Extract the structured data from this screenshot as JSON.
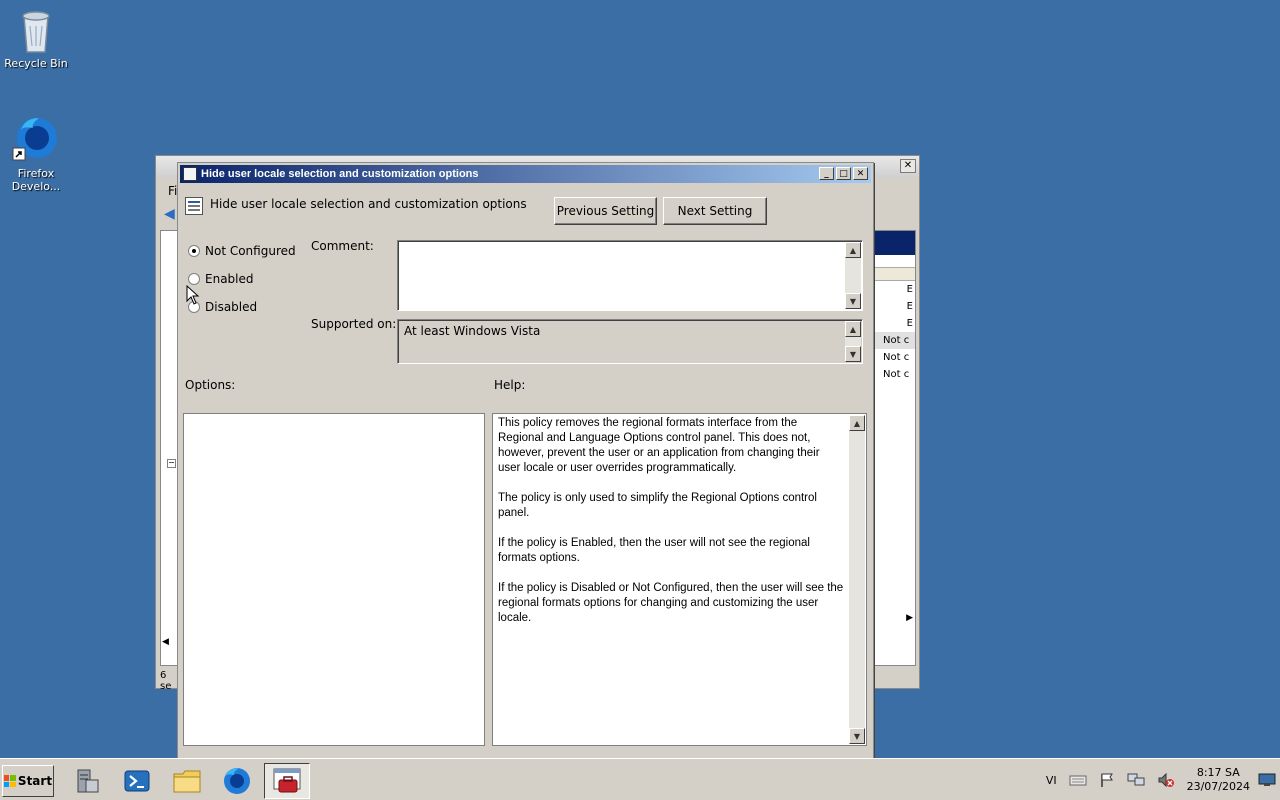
{
  "desktop": {
    "icons": [
      {
        "label": "Recycle Bin",
        "icon": "recycle-bin-icon"
      },
      {
        "label": "Firefox\nDevelo...",
        "icon": "firefox-developer-icon"
      }
    ]
  },
  "background_window": {
    "menu_fragment": "Fi",
    "status_fragment": "6 se",
    "right_items": [
      "E",
      "E",
      "E",
      "Not c",
      "Not c",
      "Not c"
    ]
  },
  "dialog": {
    "title": "Hide user locale selection and customization options",
    "policy_name": "Hide user locale selection and customization options",
    "previous_button": "Previous Setting",
    "next_button": "Next Setting",
    "state_options": [
      {
        "label": "Not Configured",
        "checked": true
      },
      {
        "label": "Enabled",
        "checked": false
      },
      {
        "label": "Disabled",
        "checked": false
      }
    ],
    "comment_label": "Comment:",
    "comment_value": "",
    "supported_label": "Supported on:",
    "supported_value": "At least Windows Vista",
    "options_label": "Options:",
    "help_label": "Help:",
    "help_paragraphs": [
      "This policy removes the regional formats interface from the Regional and Language Options control panel.  This does not, however, prevent the user or an application from changing their user locale or user overrides programmatically.",
      "The policy is only used to simplify the Regional Options control panel.",
      "If the policy is Enabled, then the user will not see the regional formats options.",
      "If the policy is Disabled or Not Configured, then the user will see the regional formats options for changing and customizing the user locale."
    ]
  },
  "taskbar": {
    "start_label": "Start",
    "language": "VI",
    "time": "8:17 SA",
    "date": "23/07/2024",
    "apps": [
      "server-manager-icon",
      "powershell-icon",
      "file-explorer-icon",
      "firefox-icon",
      "group-policy-editor-icon"
    ]
  },
  "colors": {
    "desktop": "#3a6ea5",
    "title_active_start": "#0a246a",
    "title_active_end": "#a6caf0"
  }
}
